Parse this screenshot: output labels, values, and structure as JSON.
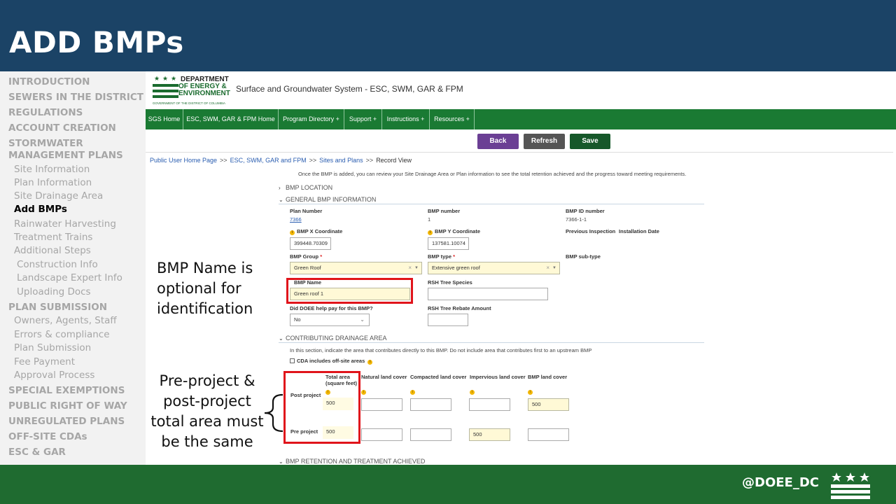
{
  "slide": {
    "title": "ADD BMPs",
    "handle": "@DOEE_DC"
  },
  "nav": {
    "items": [
      {
        "label": "INTRODUCTION"
      },
      {
        "label": "SEWERS IN THE DISTRICT"
      },
      {
        "label": "REGULATIONS"
      },
      {
        "label": "ACCOUNT CREATION"
      },
      {
        "label": "STORMWATER"
      },
      {
        "label": "MANAGEMENT PLANS"
      },
      {
        "label": "Site Information"
      },
      {
        "label": "Plan Information"
      },
      {
        "label": "Site Drainage Area"
      },
      {
        "label": "Add BMPs"
      },
      {
        "label": "Rainwater Harvesting"
      },
      {
        "label": "Treatment Trains"
      },
      {
        "label": "Additional Steps"
      },
      {
        "label": "Construction Info"
      },
      {
        "label": "Landscape Expert Info"
      },
      {
        "label": "Uploading Docs"
      },
      {
        "label": "PLAN SUBMISSION"
      },
      {
        "label": "Owners, Agents, Staff"
      },
      {
        "label": "Errors & compliance"
      },
      {
        "label": "Plan Submission"
      },
      {
        "label": "Fee Payment"
      },
      {
        "label": "Approval Process"
      },
      {
        "label": "SPECIAL EXEMPTIONS"
      },
      {
        "label": "PUBLIC RIGHT OF WAY"
      },
      {
        "label": "UNREGULATED PLANS"
      },
      {
        "label": "OFF-SITE CDAs"
      },
      {
        "label": "ESC & GAR"
      }
    ]
  },
  "app": {
    "logo": {
      "line1": "DEPARTMENT",
      "line2": "OF ENERGY &",
      "line3": "ENVIRONMENT",
      "line4": "GOVERNMENT OF THE DISTRICT OF COLUMBIA"
    },
    "title": "Surface and Groundwater System - ESC, SWM, GAR & FPM",
    "menu": [
      "SGS Home",
      "ESC, SWM, GAR & FPM Home",
      "Program Directory +",
      "Support +",
      "Instructions +",
      "Resources +"
    ],
    "buttons": {
      "back": "Back",
      "refresh": "Refresh",
      "save": "Save"
    },
    "breadcrumb": {
      "items": [
        "Public User Home Page",
        "SWM, GAR and FPM",
        "Sites and Plans",
        "Record View"
      ],
      "prefix2": "ESC,",
      "sep": ">>"
    },
    "note": "Once the BMP is added, you can review your Site Drainage Area or Plan information to see the total retention achieved and the progress toward meeting requirements.",
    "sections": {
      "location": "BMP LOCATION",
      "general": "GENERAL BMP INFORMATION",
      "cda": "CONTRIBUTING DRAINAGE AREA",
      "retention": "BMP RETENTION AND TREATMENT ACHIEVED"
    },
    "general": {
      "plan_number_label": "Plan Number",
      "plan_number": "7366",
      "bmp_number_label": "BMP number",
      "bmp_number": "1",
      "bmp_id_label": "BMP ID number",
      "bmp_id": "7366-1-1",
      "x_label": "BMP X Coordinate",
      "x_value": "399448.70309",
      "y_label": "BMP Y Coordinate",
      "y_value": "137581.10074",
      "prev_inspection_label": "Previous Inspection",
      "install_date_label": "Installation Date",
      "group_label": "BMP Group",
      "group_value": "Green Roof",
      "type_label": "BMP type",
      "type_value": "Extensive green roof",
      "subtype_label": "BMP sub-type",
      "name_label": "BMP Name",
      "name_value": "Green roof 1",
      "rsh_species_label": "RSH Tree Species",
      "doee_label": "Did DOEE help pay for this BMP?",
      "doee_value": "No",
      "rsh_rebate_label": "RSH Tree Rebate Amount",
      "required_mark": "*",
      "clear_mark": "×",
      "caret": "▼"
    },
    "cda": {
      "note": "In this section, indicate the area that contributes directly to this BMP. Do not include area that contributes first to an upstream BMP",
      "offsite_label": "CDA includes off-site areas",
      "col_total_1": "Total area",
      "col_total_2": "(square feet)",
      "col_natural": "Natural land cover",
      "col_compacted": "Compacted land cover",
      "col_impervious": "Impervious land cover",
      "col_bmp": "BMP land cover",
      "post_label": "Post project",
      "pre_label": "Pre project",
      "post_total": "500",
      "post_bmp": "500",
      "pre_total": "500",
      "pre_impervious": "500"
    }
  },
  "annotations": {
    "name_note": [
      "BMP Name is",
      "optional for",
      "identification"
    ],
    "area_note": [
      "Pre-project &",
      "post-project",
      "total area must",
      "be the same"
    ]
  },
  "colors": {
    "header": "#1b4366",
    "footer": "#1f6b30",
    "menu_green": "#1a7a33",
    "back_btn": "#6b3f94",
    "refresh_btn": "#555555",
    "save_btn": "#16582a",
    "highlight_red": "#e0141b"
  }
}
